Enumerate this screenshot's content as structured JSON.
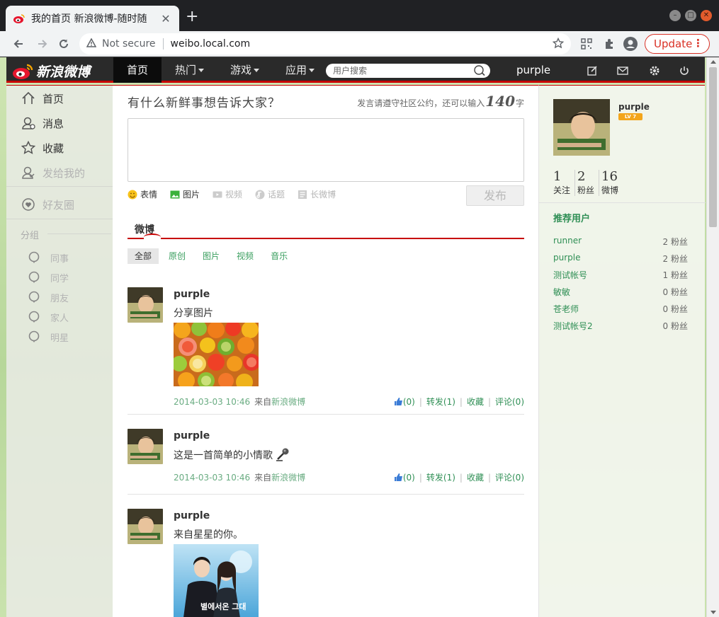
{
  "browser": {
    "tab_title": "我的首页 新浪微博-随时随",
    "address_security": "Not secure",
    "address_url": "weibo.local.com",
    "update_label": "Update"
  },
  "weibo_nav": {
    "logo_text": "新浪微博",
    "items": [
      {
        "label": "首页"
      },
      {
        "label": "热门"
      },
      {
        "label": "游戏"
      },
      {
        "label": "应用"
      }
    ],
    "search_placeholder": "用户搜索",
    "username": "purple"
  },
  "left_nav": {
    "items": [
      {
        "label": "首页"
      },
      {
        "label": "消息"
      },
      {
        "label": "收藏"
      },
      {
        "label": "发给我的"
      }
    ],
    "friends_circle": "好友圈",
    "group_title": "分组",
    "groups": [
      {
        "label": "同事"
      },
      {
        "label": "同学"
      },
      {
        "label": "朋友"
      },
      {
        "label": "家人"
      },
      {
        "label": "明星"
      }
    ]
  },
  "composer": {
    "title": "有什么新鲜事想告诉大家？",
    "hint_prefix": "发言请遵守社区公约，还可以输入",
    "hint_count": "140",
    "hint_suffix": "字",
    "tools": [
      {
        "label": "表情"
      },
      {
        "label": "图片"
      },
      {
        "label": "视频"
      },
      {
        "label": "话题"
      },
      {
        "label": "长微博"
      }
    ],
    "publish_label": "发布"
  },
  "feed": {
    "tab_label": "微博",
    "filters": [
      {
        "label": "全部"
      },
      {
        "label": "原创"
      },
      {
        "label": "图片"
      },
      {
        "label": "视频"
      },
      {
        "label": "音乐"
      }
    ],
    "posts": [
      {
        "author": "purple",
        "text": "分享图片",
        "time": "2014-03-03 10:46",
        "via_prefix": "来自",
        "via": "新浪微博",
        "likes": "(0)",
        "repost": "转发(1)",
        "favorite": "收藏",
        "comment": "评论(0)"
      },
      {
        "author": "purple",
        "text": "这是一首简单的小情歌",
        "time": "2014-03-03 10:46",
        "via_prefix": "来自",
        "via": "新浪微博",
        "likes": "(0)",
        "repost": "转发(1)",
        "favorite": "收藏",
        "comment": "评论(0)"
      },
      {
        "author": "purple",
        "text": "来自星星的你。",
        "poster_text": "별에서온 그대"
      }
    ]
  },
  "profile": {
    "name": "purple",
    "level": "LV 7",
    "stats": [
      {
        "num": "1",
        "label": "关注"
      },
      {
        "num": "2",
        "label": "粉丝"
      },
      {
        "num": "16",
        "label": "微博"
      }
    ]
  },
  "recommend": {
    "title": "推荐用户",
    "users": [
      {
        "name": "runner",
        "count": "2 粉丝"
      },
      {
        "name": "purple",
        "count": "2 粉丝"
      },
      {
        "name": "测试帐号",
        "count": "1 粉丝"
      },
      {
        "name": "敏敏",
        "count": "0 粉丝"
      },
      {
        "name": "苍老师",
        "count": "0 粉丝"
      },
      {
        "name": "测试帐号2",
        "count": "0 粉丝"
      }
    ]
  },
  "colors": {
    "weibo_red": "#c70000",
    "link_green": "#2f8f55",
    "nav_dark": "#2a2a2a"
  }
}
